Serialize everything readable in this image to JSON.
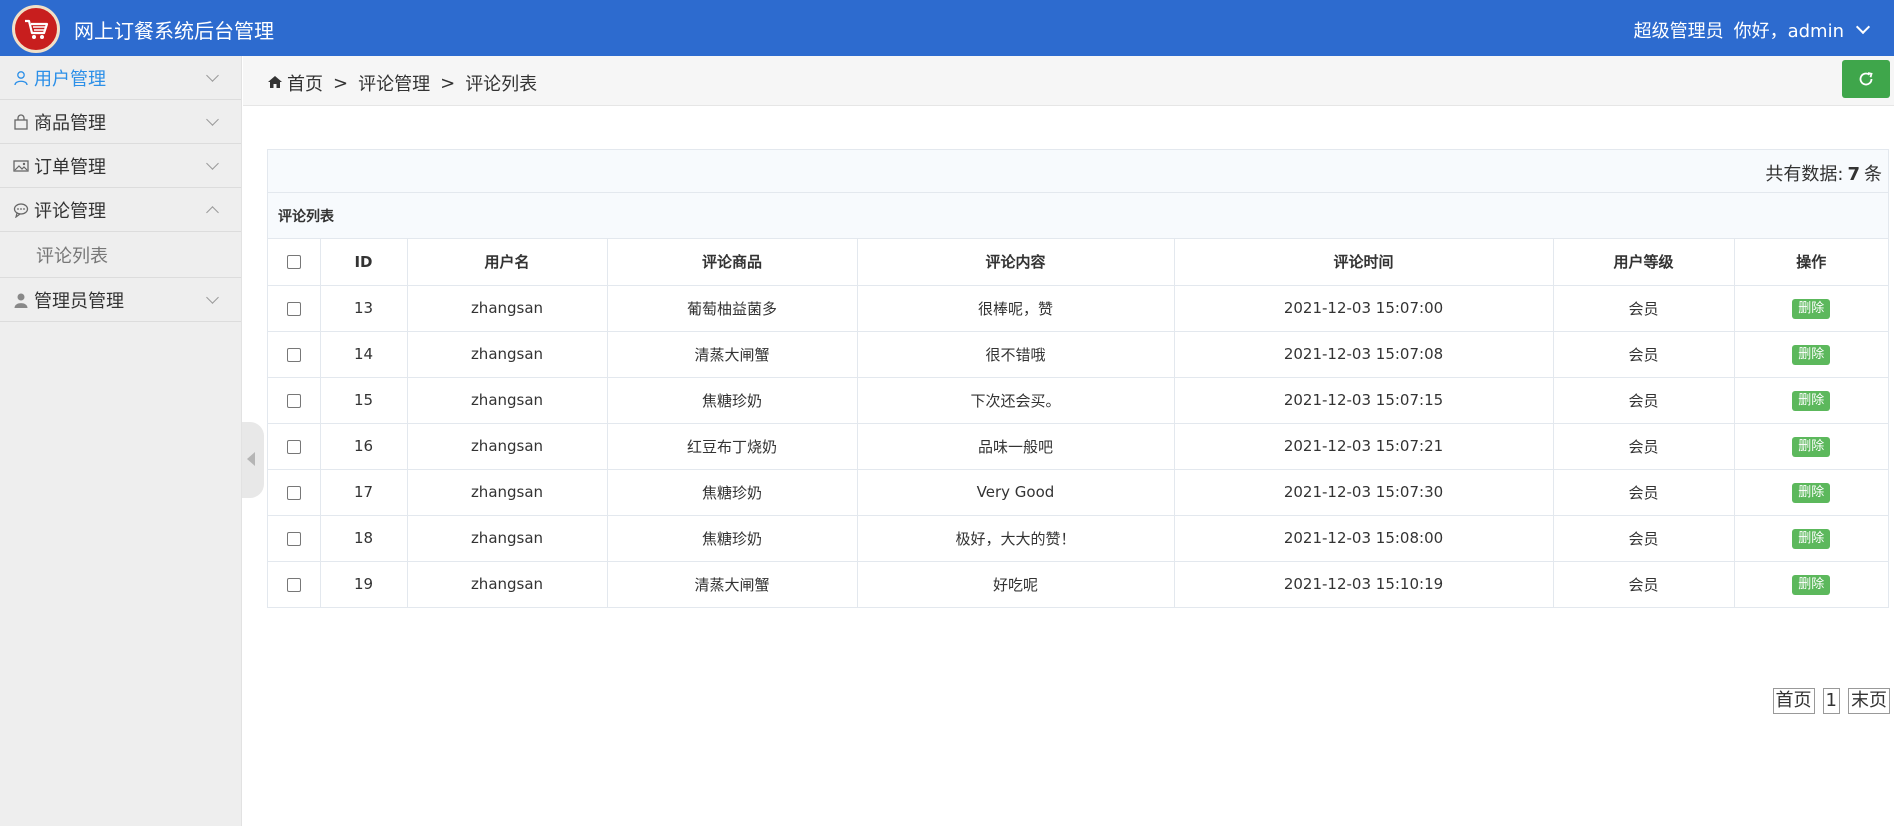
{
  "header": {
    "title": "网上订餐系统后台管理",
    "role": "超级管理员",
    "greeting": "你好，admin"
  },
  "sidebar": {
    "items": [
      {
        "label": "用户管理",
        "icon": "user-outline-icon",
        "active": true
      },
      {
        "label": "商品管理",
        "icon": "bag-icon"
      },
      {
        "label": "订单管理",
        "icon": "image-icon"
      },
      {
        "label": "评论管理",
        "icon": "chat-bubble-icon",
        "expanded": true
      },
      {
        "label": "管理员管理",
        "icon": "user-solid-icon"
      }
    ],
    "submenu": [
      "评论列表"
    ]
  },
  "breadcrumb": {
    "home": "首页",
    "sep": ">",
    "level1": "评论管理",
    "level2": "评论列表"
  },
  "summary": {
    "prefix": "共有数据:",
    "count": "7",
    "suffix": "条"
  },
  "table": {
    "title": "评论列表",
    "columns": [
      "ID",
      "用户名",
      "评论商品",
      "评论内容",
      "评论时间",
      "用户等级",
      "操作"
    ],
    "delete_label": "删除",
    "rows": [
      {
        "id": "13",
        "user": "zhangsan",
        "product": "葡萄柚益菌多",
        "content": "很棒呢，赞",
        "time": "2021-12-03 15:07:00",
        "level": "会员"
      },
      {
        "id": "14",
        "user": "zhangsan",
        "product": "清蒸大闸蟹",
        "content": "很不错哦",
        "time": "2021-12-03 15:07:08",
        "level": "会员"
      },
      {
        "id": "15",
        "user": "zhangsan",
        "product": "焦糖珍奶",
        "content": "下次还会买。",
        "time": "2021-12-03 15:07:15",
        "level": "会员"
      },
      {
        "id": "16",
        "user": "zhangsan",
        "product": "红豆布丁烧奶",
        "content": "品味一般吧",
        "time": "2021-12-03 15:07:21",
        "level": "会员"
      },
      {
        "id": "17",
        "user": "zhangsan",
        "product": "焦糖珍奶",
        "content": "Very Good",
        "time": "2021-12-03 15:07:30",
        "level": "会员"
      },
      {
        "id": "18",
        "user": "zhangsan",
        "product": "焦糖珍奶",
        "content": "极好，大大的赞！",
        "time": "2021-12-03 15:08:00",
        "level": "会员"
      },
      {
        "id": "19",
        "user": "zhangsan",
        "product": "清蒸大闸蟹",
        "content": "好吃呢",
        "time": "2021-12-03 15:10:19",
        "level": "会员"
      }
    ]
  },
  "pagination": {
    "first": "首页",
    "current": "1",
    "last": "末页"
  },
  "colors": {
    "header_bg": "#2d6bcf",
    "active_menu": "#2b8fe8",
    "success": "#5cb85c",
    "refresh": "#3fa64b"
  }
}
